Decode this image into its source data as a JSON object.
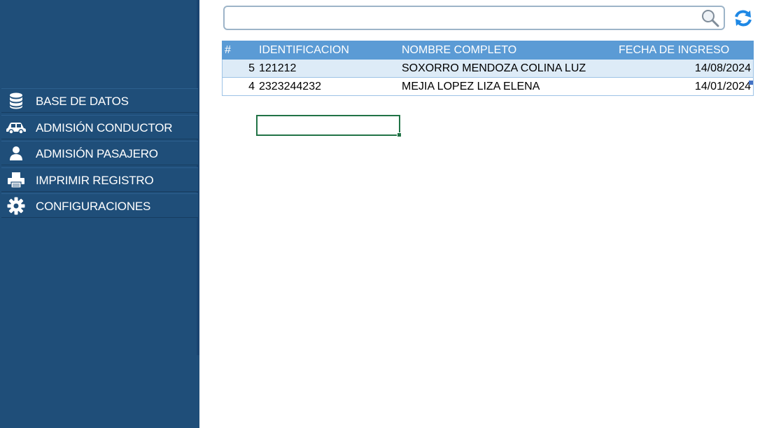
{
  "sidebar": {
    "items": [
      {
        "label": "BASE DE DATOS",
        "icon": "database-icon"
      },
      {
        "label": "ADMISIÓN CONDUCTOR",
        "icon": "car-icon"
      },
      {
        "label": "ADMISIÓN PASAJERO",
        "icon": "user-icon"
      },
      {
        "label": "IMPRIMIR REGISTRO",
        "icon": "printer-icon"
      },
      {
        "label": "CONFIGURACIONES",
        "icon": "gear-icon"
      }
    ]
  },
  "search": {
    "value": "",
    "placeholder": "",
    "icon": "search-icon"
  },
  "refresh": {
    "icon": "refresh-icon"
  },
  "table": {
    "headers": [
      "#",
      "IDENTIFICACION",
      "NOMBRE COMPLETO",
      "FECHA DE INGRESO"
    ],
    "rows": [
      [
        "5",
        "121212",
        "SOXORRO MENDOZA COLINA LUZ",
        "14/08/2024"
      ],
      [
        "4",
        "2323244232",
        "MEJIA LOPEZ LIZA ELENA",
        "14/01/2024"
      ]
    ]
  },
  "colors": {
    "sidebar": "#1f4e79",
    "header": "#5b9bd5",
    "row_alt": "#ddebf7",
    "refresh_icon": "#1e88e5",
    "selection": "#217346"
  }
}
